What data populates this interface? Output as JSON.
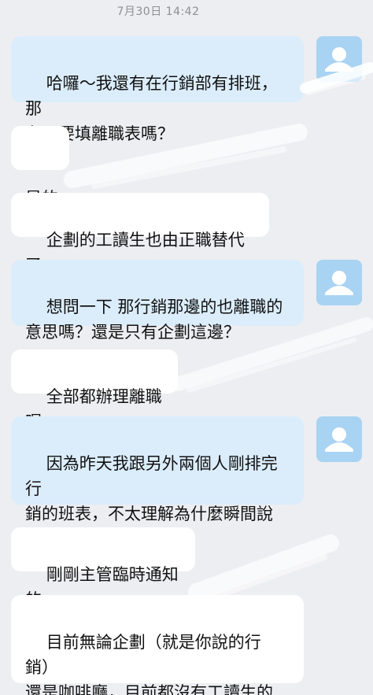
{
  "chat": {
    "timestamp": "7月30日 14:42",
    "messages": [
      {
        "direction": "sent",
        "text": "哈囉～我還有在行銷部有排班，那\n有需要填離職表嗎？"
      },
      {
        "direction": "received",
        "text": "是的"
      },
      {
        "direction": "received",
        "text": "企劃的工讀生也由正職替代了"
      },
      {
        "direction": "sent",
        "text": "想問一下 那行銷那邊的也離職的\n意思嗎？還是只有企劃這邊？"
      },
      {
        "direction": "received",
        "text": "全部都辦理離職喔"
      },
      {
        "direction": "sent",
        "text": "因為昨天我跟另外兩個人剛排完行\n銷的班表，不太理解為什麼瞬間說\n不需要了"
      },
      {
        "direction": "received",
        "text": "剛剛主管臨時通知的"
      },
      {
        "direction": "received",
        "text": "目前無論企劃（就是你說的行銷）\n還是咖啡廳，目前都沒有工讀生的\n需求了，一切都以正職人力為主"
      }
    ]
  },
  "colors": {
    "background": "#edeef2",
    "sent_bubble": "#dbedfb",
    "received_bubble": "#ffffff",
    "avatar_bg": "#a9d3f2"
  },
  "icons": {
    "avatar": "default-user-avatar-icon"
  }
}
